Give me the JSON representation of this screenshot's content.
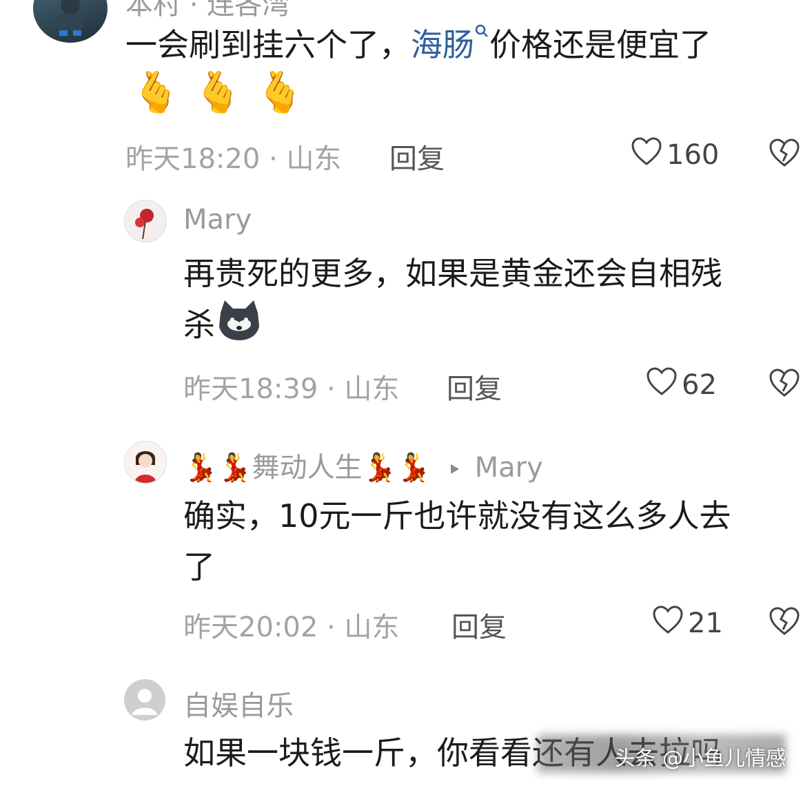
{
  "comments": [
    {
      "username": "本村 · 连各湾",
      "text_before_link": "一会刷到挂六个了，",
      "link_text": "海肠",
      "text_after_link": "价格还是便宜了",
      "emojis": "🫰🫰🫰",
      "time": "昨天18:20",
      "location": "山东",
      "reply_label": "回复",
      "likes": "160"
    },
    {
      "username": "Mary",
      "text": "再贵死的更多，如果是黄金还会自相残",
      "text_line2": "杀",
      "emoji": "🐺",
      "time": "昨天18:39",
      "location": "山东",
      "reply_label": "回复",
      "likes": "62"
    },
    {
      "username": "💃💃舞动人生💃💃",
      "reply_to": "Mary",
      "text": "确实，10元一斤也许就没有这么多人去",
      "text_line2": "了",
      "time": "昨天20:02",
      "location": "山东",
      "reply_label": "回复",
      "likes": "21"
    },
    {
      "username": "自娱自乐",
      "text": "如果一块钱一斤，你看看还有人去拉吗"
    }
  ],
  "separator": "·",
  "watermark": "头条 @小鱼儿情感",
  "colors": {
    "link": "#2f5f9c",
    "meta": "#a3a3a3",
    "username": "#9a9a9a"
  }
}
